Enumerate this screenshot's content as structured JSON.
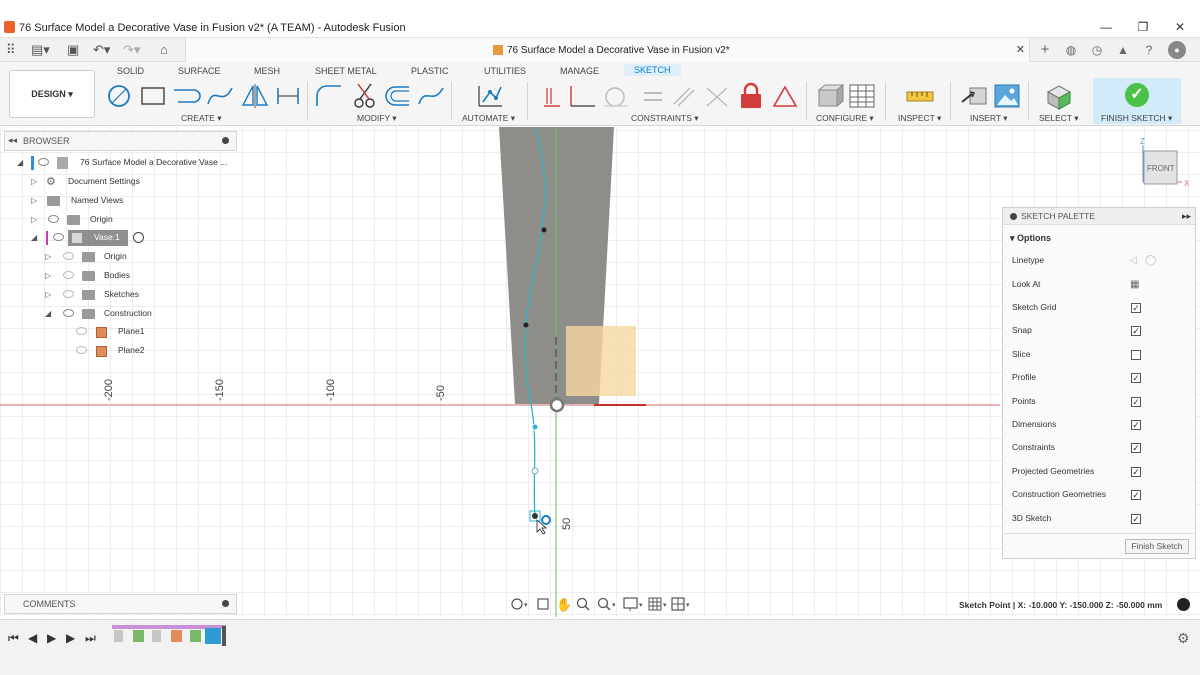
{
  "window": {
    "title": "76 Surface Model a Decorative Vase in Fusion v2* (A TEAM) - Autodesk Fusion"
  },
  "document": {
    "tab_title": "76 Surface Model a Decorative Vase in Fusion v2*"
  },
  "ribbon": {
    "workspace": "DESIGN ▾",
    "tabs": [
      "SOLID",
      "SURFACE",
      "MESH",
      "SHEET METAL",
      "PLASTIC",
      "UTILITIES",
      "MANAGE",
      "SKETCH"
    ],
    "groups": {
      "create": "CREATE ▾",
      "modify": "MODIFY ▾",
      "automate": "AUTOMATE ▾",
      "constraints": "CONSTRAINTS ▾",
      "configure": "CONFIGURE ▾",
      "inspect": "INSPECT ▾",
      "insert": "INSERT ▾",
      "select": "SELECT ▾",
      "finish": "FINISH SKETCH ▾"
    }
  },
  "browser": {
    "title": "BROWSER",
    "items": [
      {
        "label": "76 Surface Model a Decorative Vase ..."
      },
      {
        "label": "Document Settings"
      },
      {
        "label": "Named Views"
      },
      {
        "label": "Origin"
      },
      {
        "label": "Vase:1"
      },
      {
        "label": "Origin"
      },
      {
        "label": "Bodies"
      },
      {
        "label": "Sketches"
      },
      {
        "label": "Construction"
      },
      {
        "label": "Plane1"
      },
      {
        "label": "Plane2"
      }
    ]
  },
  "viewcube": {
    "face": "FRONT",
    "axis_z": "Z",
    "axis_x": "X"
  },
  "rulers": {
    "neg200": "-200",
    "neg150": "-150",
    "neg100": "-100",
    "neg50": "-50",
    "pos50": "50"
  },
  "palette": {
    "title": "SKETCH PALETTE",
    "section": "Options",
    "linetype": "Linetype",
    "look_at": "Look At",
    "options": [
      {
        "label": "Sketch Grid",
        "checked": true
      },
      {
        "label": "Snap",
        "checked": true
      },
      {
        "label": "Slice",
        "checked": false
      },
      {
        "label": "Profile",
        "checked": true
      },
      {
        "label": "Points",
        "checked": true
      },
      {
        "label": "Dimensions",
        "checked": true
      },
      {
        "label": "Constraints",
        "checked": true
      },
      {
        "label": "Projected Geometries",
        "checked": true
      },
      {
        "label": "Construction Geometries",
        "checked": true
      },
      {
        "label": "3D Sketch",
        "checked": true
      }
    ],
    "finish_button": "Finish Sketch"
  },
  "comments": {
    "title": "COMMENTS"
  },
  "status": {
    "text": "Sketch Point | X: -10.000 Y: -150.000 Z: -50.000 mm"
  },
  "colors": {
    "accent": "#0a7fc2",
    "finish_green": "#4bc14a",
    "axis_red": "#d9534f",
    "axis_green": "#5cb85c",
    "spline": "#2ab5c9"
  }
}
